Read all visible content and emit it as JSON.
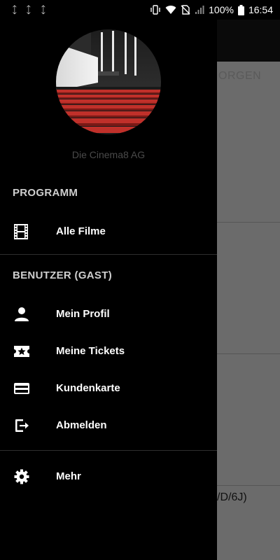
{
  "status_bar": {
    "left_icons": [
      "expand-icon",
      "expand-icon",
      "expand-icon"
    ],
    "battery": "100%",
    "time": "16:54"
  },
  "background": {
    "tab_partial": "ORGEN",
    "partial_text": "/D/6J)"
  },
  "drawer": {
    "header": {
      "tagline": "Die Cinema8 AG"
    },
    "sections": [
      {
        "title": "PROGRAMM",
        "items": [
          {
            "label": "Alle Filme",
            "icon": "film-icon"
          }
        ]
      },
      {
        "title": "BENUTZER (GAST)",
        "items": [
          {
            "label": "Mein Profil",
            "icon": "person-icon"
          },
          {
            "label": "Meine Tickets",
            "icon": "ticket-icon"
          },
          {
            "label": "Kundenkarte",
            "icon": "card-icon"
          },
          {
            "label": "Abmelden",
            "icon": "logout-icon"
          }
        ]
      },
      {
        "title": "",
        "items": [
          {
            "label": "Mehr",
            "icon": "gear-icon"
          }
        ]
      }
    ]
  },
  "colors": {
    "drawer_bg": "#000000",
    "scrim": "#6b6b6b",
    "cinema_seats": "#c0302a"
  }
}
